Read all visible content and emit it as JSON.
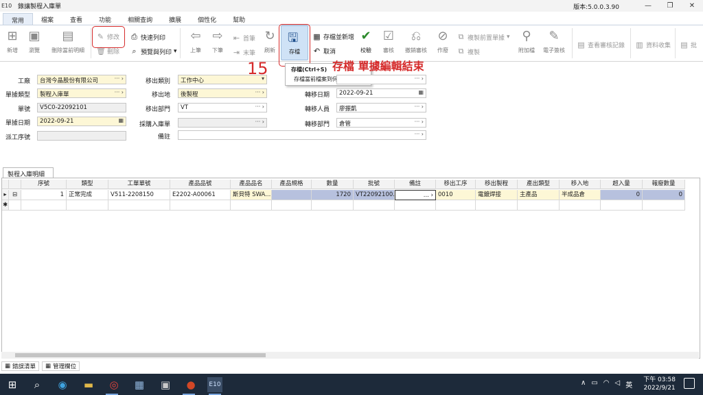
{
  "app": {
    "code": "E10",
    "title": "錄讓製程入庫單",
    "version": "版本:5.0.0.3.90",
    "controls": [
      "—",
      "❐",
      "✕"
    ]
  },
  "menu": {
    "tabs": [
      "常用",
      "檔案",
      "查看",
      "功能",
      "相關查詢",
      "擴展",
      "個性化",
      "幫助"
    ]
  },
  "ribbon": {
    "new": "新增",
    "browse": "瀏覽",
    "delete_detail": "刪除當前明細",
    "modify": "修改",
    "remove": "刪除",
    "quick_print": "快速列印",
    "preview_print": "預覽與列印",
    "prev": "上筆",
    "next": "下筆",
    "first": "首筆",
    "last": "末筆",
    "refresh": "刷新",
    "save": "存檔",
    "save_new": "存檔並新增",
    "cancel": "取消",
    "validate": "校驗",
    "audit": "審核",
    "unaudit": "撤銷審核",
    "void": "作廢",
    "copy_prev": "複製前置單據",
    "copy": "複製",
    "attach": "附加檔",
    "esign": "電子簽核",
    "view_audit": "查看審核記錄",
    "collect": "資料收集",
    "batch": "批"
  },
  "tooltip": {
    "title": "存檔(Ctrl+S)",
    "desc": "存檔當前檔案到伺服器中。"
  },
  "annotation": {
    "step": "15",
    "text": "存檔 單據編輯結束"
  },
  "form": {
    "factory_label": "工廠",
    "factory": "台灣今晶股份有限公司",
    "doctype_label": "單據類型",
    "doctype": "製程入庫單",
    "docno_label": "單號",
    "docno": "V5C0-22092101",
    "docdate_label": "單據日期",
    "docdate": "2022-09-21",
    "source_label": "派工序號",
    "source": "",
    "from_type_label": "移出類別",
    "from_type": "工作中心",
    "from_loc_label": "移出地",
    "from_loc": "後製程",
    "from_dept_label": "移出部門",
    "from_dept": "VT",
    "purchase_label": "採購入庫單",
    "purchase": "",
    "remark_label": "備註",
    "remark": "",
    "move_date_label": "轉移日期",
    "move_date": "2022-09-21",
    "move_person_label": "轉移人員",
    "move_person": "廖振凱",
    "move_dept_label": "轉移部門",
    "move_dept": "倉管"
  },
  "grid": {
    "tab": "製程入庫明細",
    "columns": [
      "序號",
      "類型",
      "工單單號",
      "產品品號",
      "產品品名",
      "產品規格",
      "數量",
      "批號",
      "備註",
      "移出工序",
      "移出製程",
      "產出類型",
      "移入地",
      "超入量",
      "報廢數量"
    ],
    "rows": [
      {
        "seq": "1",
        "type": "正常完成",
        "wo": "V511-2208150",
        "item": "E2202-A00061",
        "name": "斯貝特 SWA...",
        "spec": "",
        "qty": "1720",
        "lot": "VT22092100...",
        "remark": "...",
        "op": "0010",
        "process": "電鍍焊接",
        "out_type": "主產品",
        "to_loc": "半成品倉",
        "over": "0",
        "scrap": "0"
      }
    ]
  },
  "bottom_tabs": [
    "錯誤清單",
    "管理欄位"
  ],
  "taskbar": {
    "app_label": "E10",
    "ime": "英",
    "time": "下午 03:58",
    "date": "2022/9/21"
  },
  "colors": {
    "annotation_red": "#d52a2a",
    "required_field": "#fdf7d6",
    "taskbar": "#1d2a3a"
  }
}
